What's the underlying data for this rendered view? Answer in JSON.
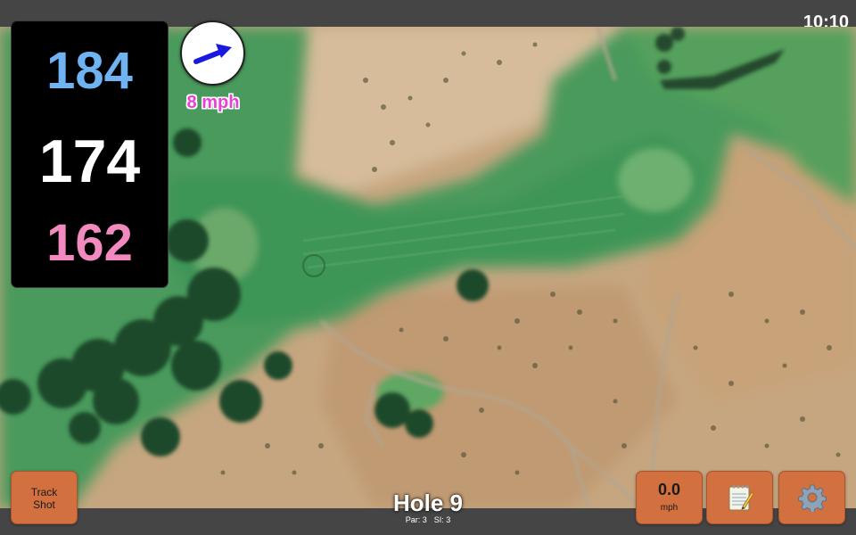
{
  "status_bar": {
    "time": "10:10"
  },
  "distances": {
    "back": "184",
    "middle": "174",
    "front": "162",
    "back_color": "#6fb3f2",
    "middle_color": "#ffffff",
    "front_color": "#f28ac0"
  },
  "wind": {
    "speed": "8 mph",
    "icon": "wind-direction-arrow-icon",
    "arrow_color": "#1a1adf",
    "speed_color": "#e83fd6"
  },
  "hole": {
    "title": "Hole 9",
    "par": "Par: 3",
    "stroke_index": "SI: 3"
  },
  "buttons": {
    "track_shot_line1": "Track",
    "track_shot_line2": "Shot",
    "speed_value": "0.0",
    "speed_unit": "mph",
    "notes_icon": "notepad-icon",
    "settings_icon": "gear-icon",
    "accent": "#d2703f"
  }
}
